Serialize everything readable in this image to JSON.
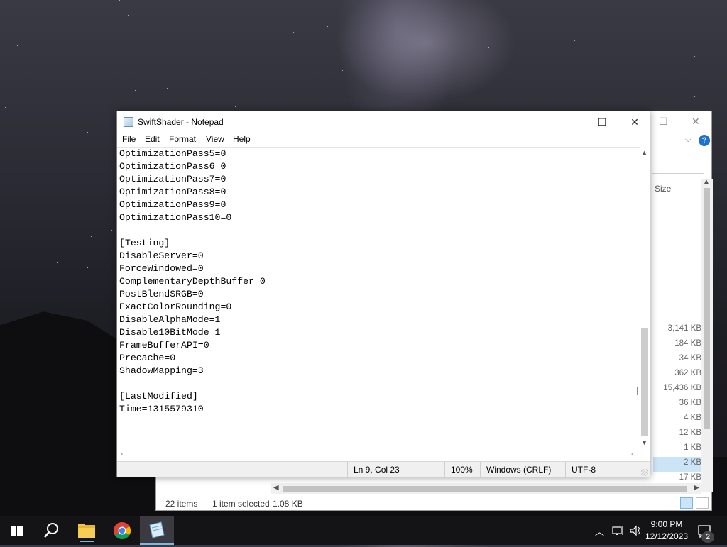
{
  "notepad": {
    "title": "SwiftShader - Notepad",
    "menu": [
      "File",
      "Edit",
      "Format",
      "View",
      "Help"
    ],
    "lines": [
      "OptimizationPass5=0",
      "OptimizationPass6=0",
      "OptimizationPass7=0",
      "OptimizationPass8=0",
      "OptimizationPass9=0",
      "OptimizationPass10=0",
      "",
      "[Testing]",
      "DisableServer=0",
      "ForceWindowed=0",
      "ComplementaryDepthBuffer=0",
      "PostBlendSRGB=0",
      "ExactColorRounding=0",
      "DisableAlphaMode=1",
      "Disable10BitMode=1",
      "FrameBufferAPI=0",
      "Precache=0",
      "ShadowMapping=3",
      "",
      "[LastModified]",
      "Time=1315579310"
    ],
    "status": {
      "position": "Ln 9, Col 23",
      "zoom": "100%",
      "line_ending": "Windows (CRLF)",
      "encoding": "UTF-8"
    }
  },
  "explorer": {
    "size_header": "Size",
    "sizes": [
      "3,141 KB",
      "184 KB",
      "34 KB",
      "362 KB",
      "15,436 KB",
      "36 KB",
      "4 KB",
      "12 KB",
      "1 KB",
      "2 KB",
      "17 KB"
    ],
    "selected_size_index": 9,
    "status": {
      "items": "22 items",
      "selected": "1 item selected",
      "selected_size": "1.08 KB"
    }
  },
  "taskbar": {
    "time": "9:00 PM",
    "date": "12/12/2023",
    "notification_count": "2"
  },
  "colors": {
    "accent": "#1f6fd1",
    "taskbar": "#141416",
    "selection": "#cce4f7"
  }
}
